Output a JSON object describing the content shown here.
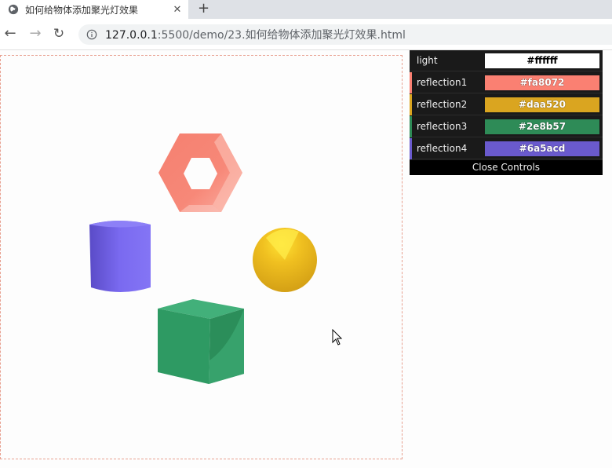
{
  "browser": {
    "tab_title": "如何给物体添加聚光灯效果",
    "tab_close": "✕",
    "new_tab": "+",
    "url_host": "127.0.0.1",
    "url_path": ":5500/demo/23.如何给物体添加聚光灯效果.html"
  },
  "controls": {
    "rows": [
      {
        "label": "light",
        "value": "#ffffff",
        "color": "#ffffff"
      },
      {
        "label": "reflection1",
        "value": "#fa8072",
        "color": "#fa8072"
      },
      {
        "label": "reflection2",
        "value": "#daa520",
        "color": "#daa520"
      },
      {
        "label": "reflection3",
        "value": "#2e8b57",
        "color": "#2e8b57"
      },
      {
        "label": "reflection4",
        "value": "#6a5acd",
        "color": "#6a5acd"
      }
    ],
    "close_label": "Close Controls"
  },
  "scene": {
    "objects": [
      {
        "name": "hexagon-torus",
        "color": "#fa8072"
      },
      {
        "name": "cylinder",
        "color": "#6a5acd"
      },
      {
        "name": "sphere",
        "color": "#daa520"
      },
      {
        "name": "cube",
        "color": "#2e8b57"
      }
    ]
  }
}
